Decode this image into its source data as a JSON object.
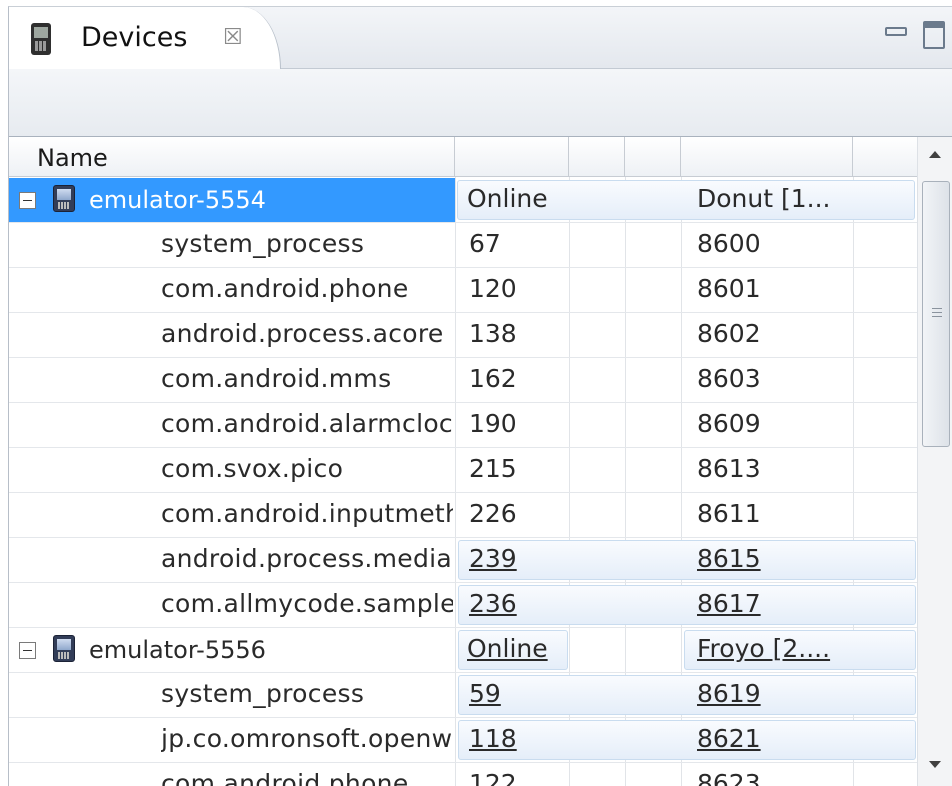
{
  "tab": {
    "title": "Devices",
    "close_glyph": "☒"
  },
  "toolbar": {
    "icons": [
      "debug-icon",
      "update-heap-icon",
      "dump-hprof-icon",
      "cause-gc-icon",
      "update-threads-icon",
      "start-method-profiling-icon",
      "stop-process-icon",
      "screen-capture-icon",
      "view-menu-icon"
    ]
  },
  "table": {
    "columns": [
      "Name",
      "",
      "",
      "",
      "",
      ""
    ],
    "rows": [
      {
        "type": "device",
        "name": "emulator-5554",
        "status": "Online",
        "build": "Donut [1...",
        "selected": true,
        "linked": false
      },
      {
        "type": "process",
        "name": "system_process",
        "pid": "67",
        "port": "8600",
        "linked": false
      },
      {
        "type": "process",
        "name": "com.android.phone",
        "pid": "120",
        "port": "8601",
        "linked": false
      },
      {
        "type": "process",
        "name": "android.process.acore",
        "pid": "138",
        "port": "8602",
        "linked": false
      },
      {
        "type": "process",
        "name": "com.android.mms",
        "pid": "162",
        "port": "8603",
        "linked": false
      },
      {
        "type": "process",
        "name": "com.android.alarmclock",
        "pid": "190",
        "port": "8609",
        "linked": false
      },
      {
        "type": "process",
        "name": "com.svox.pico",
        "pid": "215",
        "port": "8613",
        "linked": false
      },
      {
        "type": "process",
        "name": "com.android.inputmethod",
        "pid": "226",
        "port": "8611",
        "linked": false
      },
      {
        "type": "process",
        "name": "android.process.media",
        "pid": "239",
        "port": "8615",
        "linked": true
      },
      {
        "type": "process",
        "name": "com.allmycode.sample",
        "pid": "236",
        "port": "8617",
        "linked": true
      },
      {
        "type": "device",
        "name": "emulator-5556",
        "status": "Online",
        "build": "Froyo [2....",
        "selected": false,
        "linked": true
      },
      {
        "type": "process",
        "name": "system_process",
        "pid": "59",
        "port": "8619",
        "linked": true
      },
      {
        "type": "process",
        "name": "jp.co.omronsoft.openwnn",
        "pid": "118",
        "port": "8621",
        "linked": true
      },
      {
        "type": "process",
        "name": "com.android.phone",
        "pid": "122",
        "port": "8623",
        "linked": false
      }
    ]
  },
  "colors": {
    "selection": "#3399ff",
    "link_highlight": "#e5eef9"
  }
}
